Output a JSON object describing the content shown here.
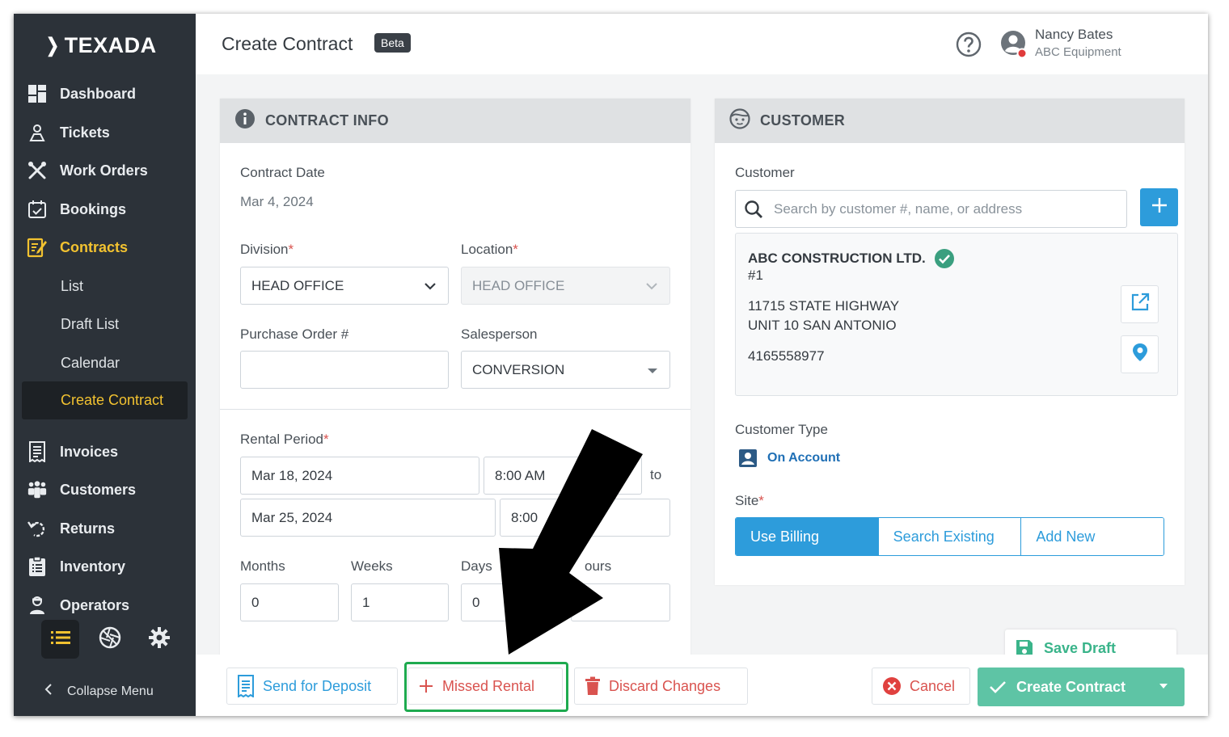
{
  "sidebar": {
    "logo": "TEXADA",
    "items": [
      {
        "label": "Dashboard"
      },
      {
        "label": "Tickets"
      },
      {
        "label": "Work Orders"
      },
      {
        "label": "Bookings"
      },
      {
        "label": "Contracts"
      },
      {
        "label": "Invoices"
      },
      {
        "label": "Customers"
      },
      {
        "label": "Returns"
      },
      {
        "label": "Inventory"
      },
      {
        "label": "Operators"
      }
    ],
    "contracts_sub": [
      "List",
      "Draft List",
      "Calendar",
      "Create Contract"
    ],
    "collapse_label": "Collapse Menu",
    "accent_color": "#f2c230"
  },
  "header": {
    "title": "Create Contract",
    "badge": "Beta",
    "user_name": "Nancy Bates",
    "user_org": "ABC Equipment"
  },
  "contract_info": {
    "title": "CONTRACT INFO",
    "contract_date_label": "Contract Date",
    "contract_date": "Mar 4, 2024",
    "division_label": "Division",
    "division_value": "HEAD OFFICE",
    "location_label": "Location",
    "location_value": "HEAD OFFICE",
    "po_label": "Purchase Order #",
    "po_value": "",
    "salesperson_label": "Salesperson",
    "salesperson_value": "CONVERSION",
    "rental_period_label": "Rental Period",
    "start_date": "Mar 18, 2024",
    "start_time": "8:00 AM",
    "to_label": "to",
    "end_date": "Mar 25, 2024",
    "end_time": "8:00",
    "months_label": "Months",
    "months_value": "0",
    "weeks_label": "Weeks",
    "weeks_value": "1",
    "days_label": "Days",
    "days_value": "0",
    "hours_label": "ours"
  },
  "customer": {
    "title": "CUSTOMER",
    "customer_label": "Customer",
    "search_placeholder": "Search by customer #, name, or address",
    "name": "ABC CONSTRUCTION LTD.",
    "number": "#1",
    "address1": "11715 STATE HIGHWAY",
    "address2": "UNIT 10 SAN ANTONIO",
    "phone": "4165558977",
    "type_label": "Customer Type",
    "type_value": "On Account",
    "site_label": "Site",
    "site_options": [
      "Use Billing",
      "Search Existing",
      "Add New"
    ]
  },
  "footer": {
    "send_deposit": "Send for Deposit",
    "missed_rental": "Missed Rental",
    "discard": "Discard Changes",
    "cancel": "Cancel",
    "create": "Create Contract",
    "save_draft": "Save Draft"
  },
  "colors": {
    "primary_blue": "#2d9cdb",
    "danger_red": "#d9534f",
    "success_green": "#5ec4a5",
    "highlight_green": "#1eaa4f"
  }
}
